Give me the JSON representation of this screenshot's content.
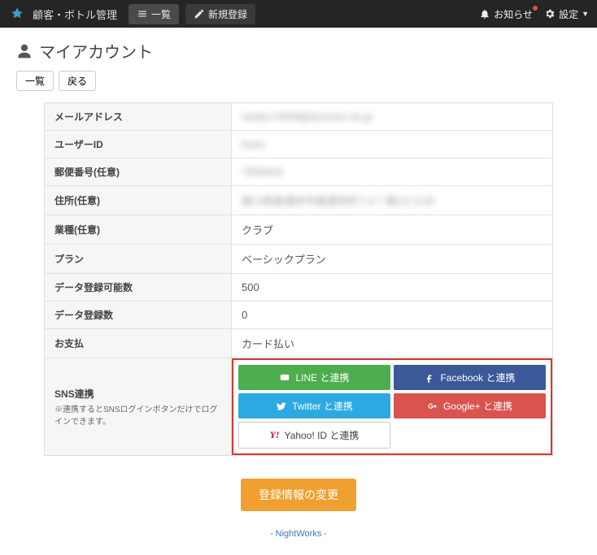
{
  "nav": {
    "brand": "顧客・ボトル管理",
    "list_label": "一覧",
    "new_label": "新規登録",
    "notice_label": "お知らせ",
    "settings_label": "設定"
  },
  "page": {
    "title": "マイアカウント",
    "btn_list": "一覧",
    "btn_back": "戻る"
  },
  "account": {
    "email_label": "メールアドレス",
    "email_value": "nanbo-0409@docomo.ne.jp",
    "userid_label": "ユーザーID",
    "userid_value": "kaori",
    "postal_label": "郵便番号(任意)",
    "postal_value": "7650043",
    "address_label": "住所(任意)",
    "address_value": "香川県善通寺市善通寺町7-3-7 第2ビル2F",
    "industry_label": "業種(任意)",
    "industry_value": "クラブ",
    "plan_label": "プラン",
    "plan_value": "ベーシックプラン",
    "capacity_label": "データ登録可能数",
    "capacity_value": "500",
    "count_label": "データ登録数",
    "count_value": "0",
    "payment_label": "お支払",
    "payment_value": "カード払い",
    "sns_label": "SNS連携",
    "sns_hint": "※連携するとSNSログインボタンだけでログインできます。"
  },
  "sns": {
    "line": "LINE と連携",
    "facebook": "Facebook と連携",
    "twitter": "Twitter と連携",
    "google": "Google+ と連携",
    "yahoo": "Yahoo! ID と連携"
  },
  "action": {
    "submit": "登録情報の変更"
  },
  "footer": {
    "text": "- NightWorks -"
  }
}
